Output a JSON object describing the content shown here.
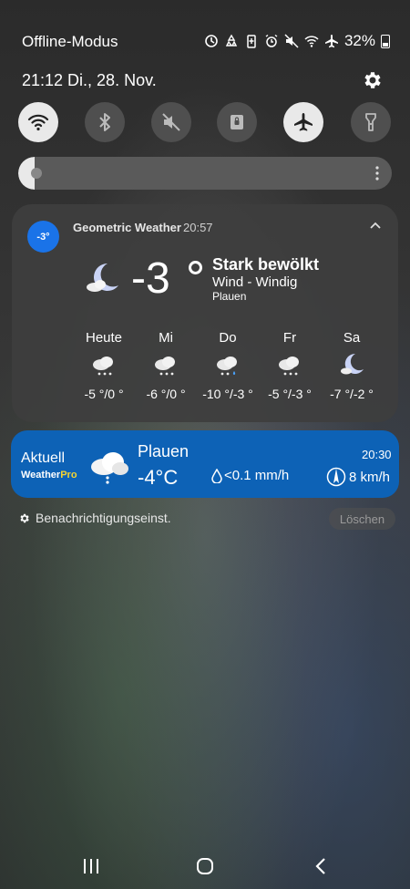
{
  "status_bar": {
    "carrier_text": "Offline-Modus",
    "battery_percent": "32%",
    "icons": [
      "sync-icon",
      "recycle-icon",
      "battery-saver-icon",
      "alarm-icon",
      "mute-icon",
      "wifi-icon",
      "airplane-icon",
      "battery-icon"
    ]
  },
  "header": {
    "datetime": "21:12  Di., 28. Nov."
  },
  "quick_settings": [
    {
      "name": "wifi",
      "active": true
    },
    {
      "name": "bluetooth",
      "active": false
    },
    {
      "name": "sound",
      "active": false
    },
    {
      "name": "screen-lock",
      "active": false
    },
    {
      "name": "airplane",
      "active": true
    },
    {
      "name": "flashlight",
      "active": false
    }
  ],
  "brightness": {
    "level": 0.04
  },
  "geometric_weather": {
    "badge": "-3°",
    "app_name": "Geometric Weather",
    "time": "20:57",
    "temperature": "-3",
    "condition": "Stark bewölkt",
    "wind": "Wind - Windig",
    "location": "Plauen",
    "forecast": [
      {
        "day": "Heute",
        "temps": "-5 °/0 °",
        "icon": "cloud-snow-icon"
      },
      {
        "day": "Mi",
        "temps": "-6 °/0 °",
        "icon": "cloud-snow-icon"
      },
      {
        "day": "Do",
        "temps": "-10 °/-3 °",
        "icon": "cloud-sleet-icon"
      },
      {
        "day": "Fr",
        "temps": "-5 °/-3 °",
        "icon": "cloud-snow-icon"
      },
      {
        "day": "Sa",
        "temps": "-7 °/-2 °",
        "icon": "moon-cloud-icon"
      }
    ]
  },
  "weatherpro": {
    "label": "Aktuell",
    "brand": "Weather",
    "brand_suffix": "Pro",
    "location": "Plauen",
    "temperature": "-4°C",
    "precipitation": "<0.1 mm/h",
    "time": "20:30",
    "wind_speed": "8 km/h"
  },
  "footer": {
    "notification_settings": "Benachrichtigungseinst.",
    "clear": "Löschen"
  },
  "colors": {
    "accent_blue": "#1a73e8",
    "weatherpro_blue": "#0d62b6",
    "pro_yellow": "#f5d431"
  }
}
